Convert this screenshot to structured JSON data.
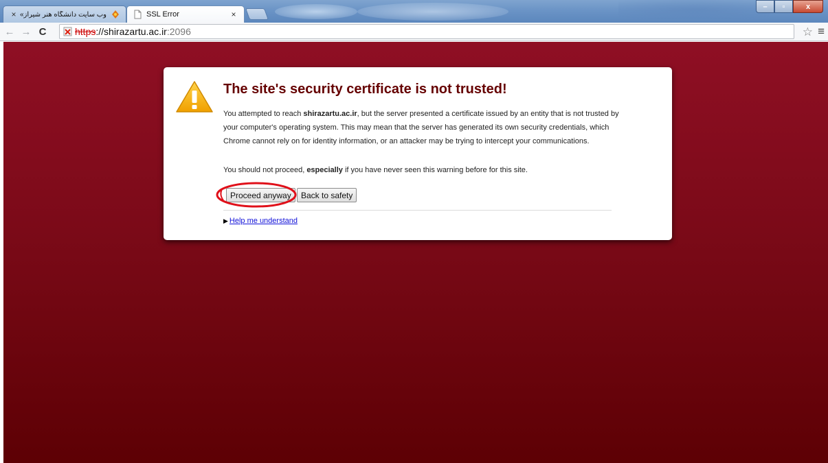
{
  "tabs": [
    {
      "title": "وب سایت دانشگاه هنر شیراز»",
      "close": "×",
      "active": false
    },
    {
      "title": "SSL Error",
      "close": "×",
      "active": true
    }
  ],
  "window_controls": {
    "minimize": "–",
    "maximize": "▫",
    "close": "x"
  },
  "toolbar": {
    "back": "←",
    "forward": "→",
    "reload": "C",
    "url_scheme": "https",
    "url_rest": "://shirazartu.ac.ir",
    "url_port": ":2096",
    "star": "☆",
    "menu": "≡"
  },
  "interstitial": {
    "heading": "The site's security certificate is not trusted!",
    "p1_before": "You attempted to reach ",
    "p1_host": "shirazartu.ac.ir",
    "p1_after": ", but the server presented a certificate issued by an entity that is not trusted by your computer's operating system. This may mean that the server has generated its own security credentials, which Chrome cannot rely on for identity information, or an attacker may be trying to intercept your communications.",
    "p2_before": "You should not proceed, ",
    "p2_bold": "especially",
    "p2_after": " if you have never seen this warning before for this site.",
    "proceed_label": "Proceed anyway",
    "back_label": "Back to safety",
    "help_label": "Help me understand"
  },
  "colors": {
    "page_top": "#8f0f24",
    "page_bottom": "#5d0004",
    "heading": "#650000",
    "link": "#1010d8",
    "annotation": "#e0101a"
  }
}
